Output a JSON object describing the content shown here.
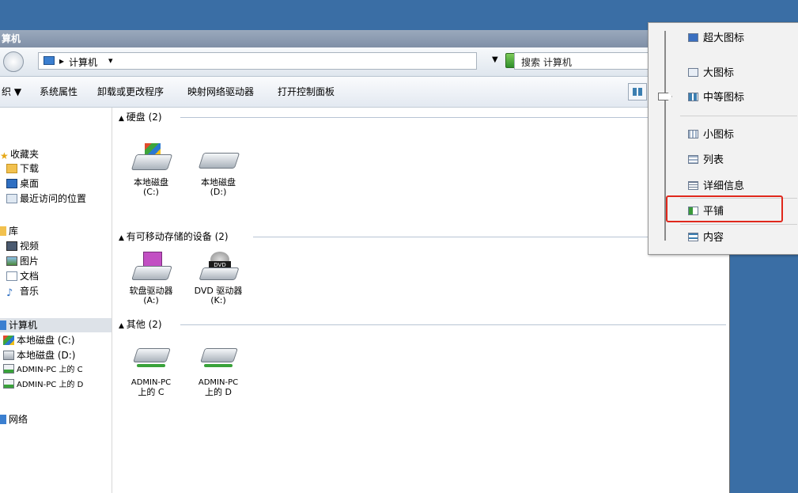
{
  "window": {
    "title": "算机",
    "address_path": "计算机",
    "search_placeholder": "搜索 计算机"
  },
  "toolbar": {
    "organize": "织 ▼",
    "items": [
      "系统属性",
      "卸载或更改程序",
      "映射网络驱动器",
      "打开控制面板"
    ]
  },
  "sidebar": {
    "favorites": {
      "label": "收藏夹",
      "items": [
        "下载",
        "桌面",
        "最近访问的位置"
      ]
    },
    "library": {
      "label": "库",
      "items": [
        "视频",
        "图片",
        "文档",
        "音乐"
      ]
    },
    "computer": {
      "label": "计算机",
      "items": [
        "本地磁盘 (C:)",
        "本地磁盘 (D:)",
        "ADMIN-PC 上的 C",
        "ADMIN-PC 上的 D"
      ]
    },
    "network": {
      "label": "网络"
    }
  },
  "groups": [
    {
      "header": "硬盘 (2)",
      "items": [
        {
          "name": "本地磁盘",
          "sub": "(C:)"
        },
        {
          "name": "本地磁盘",
          "sub": "(D:)"
        }
      ]
    },
    {
      "header": "有可移动存储的设备 (2)",
      "items": [
        {
          "name": "软盘驱动器",
          "sub": "(A:)"
        },
        {
          "name": "DVD 驱动器",
          "sub": "(K:)"
        }
      ]
    },
    {
      "header": "其他 (2)",
      "items": [
        {
          "name": "ADMIN-PC",
          "sub": "上的 C"
        },
        {
          "name": "ADMIN-PC",
          "sub": "上的 D"
        }
      ]
    }
  ],
  "view_menu": {
    "items": [
      "超大图标",
      "大图标",
      "中等图标",
      "小图标",
      "列表",
      "详细信息",
      "平铺",
      "内容"
    ],
    "highlighted": "平铺",
    "highlight_color": "#e0281c"
  },
  "colors": {
    "desktop": "#3a6ea5",
    "accent": "#3c7fb1"
  }
}
